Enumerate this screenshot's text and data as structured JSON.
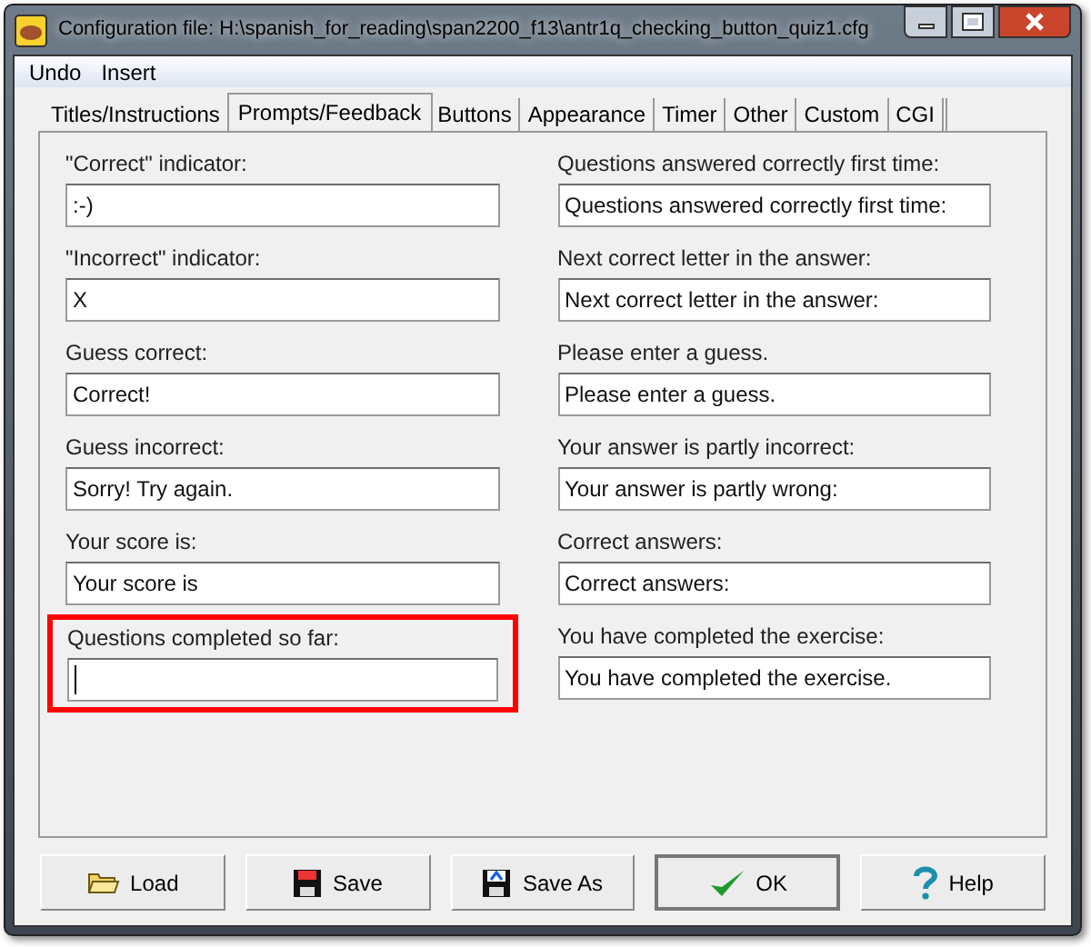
{
  "window": {
    "title": "Configuration file: H:\\spanish_for_reading\\span2200_f13\\antr1q_checking_button_quiz1.cfg"
  },
  "menu": [
    "Undo",
    "Insert"
  ],
  "tabs": [
    {
      "label": "Titles/Instructions",
      "selected": false
    },
    {
      "label": "Prompts/Feedback",
      "selected": true
    },
    {
      "label": "Buttons",
      "selected": false
    },
    {
      "label": "Appearance",
      "selected": false
    },
    {
      "label": "Timer",
      "selected": false
    },
    {
      "label": "Other",
      "selected": false
    },
    {
      "label": "Custom",
      "selected": false
    },
    {
      "label": "CGI",
      "selected": false
    }
  ],
  "left_fields": [
    {
      "label": "\"Correct\" indicator:",
      "value": ":-)",
      "highlighted": false,
      "focused": false
    },
    {
      "label": "\"Incorrect\" indicator:",
      "value": "X",
      "highlighted": false,
      "focused": false
    },
    {
      "label": "Guess correct:",
      "value": "Correct!",
      "highlighted": false,
      "focused": false
    },
    {
      "label": "Guess incorrect:",
      "value": "Sorry! Try again.",
      "highlighted": false,
      "focused": false
    },
    {
      "label": "Your score is:",
      "value": "Your score is",
      "highlighted": false,
      "focused": false
    },
    {
      "label": "Questions completed so far:",
      "highlighted": true,
      "focused": true
    }
  ],
  "right_fields": [
    {
      "label": "Questions answered correctly first time:",
      "value": "Questions answered correctly first time:",
      "highlighted": false,
      "focused": false
    },
    {
      "label": "Next correct letter in the answer:",
      "value": "Next correct letter in the answer:",
      "highlighted": false,
      "focused": false
    },
    {
      "label": "Please enter a guess.",
      "value": "Please enter a guess.",
      "highlighted": false,
      "focused": false
    },
    {
      "label": "Your answer is partly incorrect:",
      "value": "Your answer is partly wrong:",
      "highlighted": false,
      "focused": false
    },
    {
      "label": "Correct answers:",
      "value": "Correct answers:",
      "highlighted": false,
      "focused": false
    },
    {
      "label": "You have completed the exercise:",
      "value": "You have completed the exercise.",
      "highlighted": false,
      "focused": false
    }
  ],
  "buttons": [
    {
      "label": "Load",
      "kind": "load"
    },
    {
      "label": "Save",
      "kind": "save"
    },
    {
      "label": "Save As",
      "kind": "saveas"
    },
    {
      "label": "OK",
      "kind": "ok"
    },
    {
      "label": "Help",
      "kind": "help"
    }
  ]
}
